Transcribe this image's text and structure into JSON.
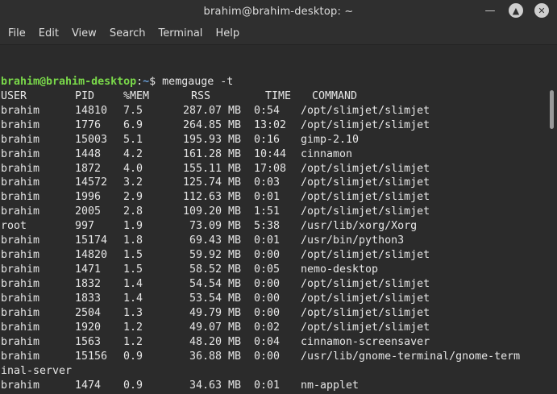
{
  "window": {
    "title": "brahim@brahim-desktop: ~"
  },
  "menu": [
    "File",
    "Edit",
    "View",
    "Search",
    "Terminal",
    "Help"
  ],
  "prompt": {
    "user_host": "brahim@brahim-desktop",
    "path": "~",
    "symbol": "$",
    "command": " memgauge -t"
  },
  "columns": [
    "USER",
    "PID",
    "%MEM",
    "RSS",
    "TIME",
    "COMMAND"
  ],
  "rows": [
    [
      "brahim",
      "14810",
      "7.5",
      "287.07 MB",
      "0:54",
      "/opt/slimjet/slimjet"
    ],
    [
      "brahim",
      "1776",
      "6.9",
      "264.85 MB",
      "13:02",
      "/opt/slimjet/slimjet"
    ],
    [
      "brahim",
      "15003",
      "5.1",
      "195.93 MB",
      "0:16",
      "gimp-2.10"
    ],
    [
      "brahim",
      "1448",
      "4.2",
      "161.28 MB",
      "10:44",
      "cinnamon"
    ],
    [
      "brahim",
      "1872",
      "4.0",
      "155.11 MB",
      "17:08",
      "/opt/slimjet/slimjet"
    ],
    [
      "brahim",
      "14572",
      "3.2",
      "125.74 MB",
      "0:03",
      "/opt/slimjet/slimjet"
    ],
    [
      "brahim",
      "1996",
      "2.9",
      "112.63 MB",
      "0:01",
      "/opt/slimjet/slimjet"
    ],
    [
      "brahim",
      "2005",
      "2.8",
      "109.20 MB",
      "1:51",
      "/opt/slimjet/slimjet"
    ],
    [
      "root",
      "997",
      "1.9",
      "73.09 MB",
      "5:38",
      "/usr/lib/xorg/Xorg"
    ],
    [
      "brahim",
      "15174",
      "1.8",
      "69.43 MB",
      "0:01",
      "/usr/bin/python3"
    ],
    [
      "brahim",
      "14820",
      "1.5",
      "59.92 MB",
      "0:00",
      "/opt/slimjet/slimjet"
    ],
    [
      "brahim",
      "1471",
      "1.5",
      "58.52 MB",
      "0:05",
      "nemo-desktop"
    ],
    [
      "brahim",
      "1832",
      "1.4",
      "54.54 MB",
      "0:00",
      "/opt/slimjet/slimjet"
    ],
    [
      "brahim",
      "1833",
      "1.4",
      "53.54 MB",
      "0:00",
      "/opt/slimjet/slimjet"
    ],
    [
      "brahim",
      "2504",
      "1.3",
      "49.79 MB",
      "0:00",
      "/opt/slimjet/slimjet"
    ],
    [
      "brahim",
      "1920",
      "1.2",
      "49.07 MB",
      "0:02",
      "/opt/slimjet/slimjet"
    ],
    [
      "brahim",
      "1563",
      "1.2",
      "48.20 MB",
      "0:04",
      "cinnamon-screensaver"
    ],
    [
      "brahim",
      "15156",
      "0.9",
      "36.88 MB",
      "0:00",
      "/usr/lib/gnome-terminal/gnome-term"
    ]
  ],
  "wrap_line": "inal-server",
  "last_row": [
    "brahim",
    "1474",
    "0.9",
    "34.63 MB",
    "0:01",
    "nm-applet"
  ]
}
